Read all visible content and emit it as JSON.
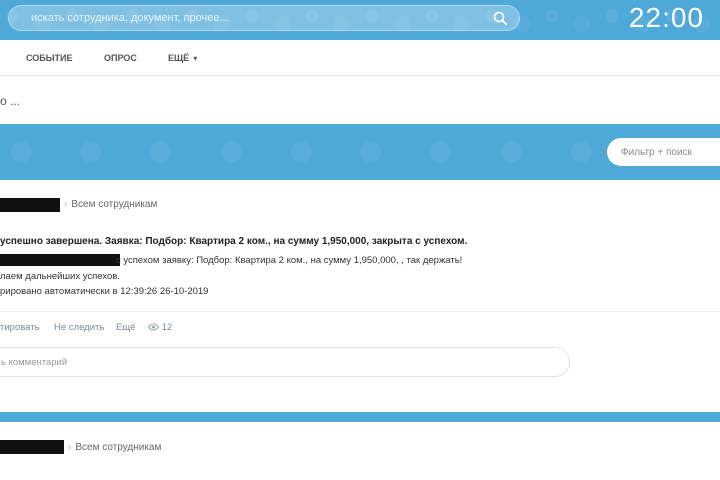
{
  "topbar": {
    "search_placeholder": "искать сотрудника, документ, прочее...",
    "clock": "22:00"
  },
  "menu": {
    "tabs": [
      {
        "label": "СОБЫТИЕ"
      },
      {
        "label": "ОПРОС"
      },
      {
        "label": "ЕЩЁ",
        "has_dropdown": true
      }
    ]
  },
  "composer": {
    "placeholder": "о ..."
  },
  "filter": {
    "placeholder": "Фильтр + поиск"
  },
  "posts": [
    {
      "recipient": "Всем сотрудникам",
      "title": "успешно завершена. Заявка: Подбор: Квартира 2 ком., на сумму 1,950,000, закрыта с успехом.",
      "body_lines": [
        "с успехом заявку: Подбор: Квартира 2 ком., на сумму 1,950,000,  , так держать!",
        "лаем дальнейших успехов.",
        "рировано автоматически в 12:39:26 26-10-2019"
      ],
      "actions": {
        "like": "тировать",
        "follow": "Не следить",
        "more": "Ещё",
        "views": "12"
      },
      "comment_placeholder": "ь комментарий"
    },
    {
      "recipient": "Всем сотрудникам"
    }
  ],
  "colors": {
    "accent_blue": "#4ea8d8",
    "redaction": "#111111"
  }
}
